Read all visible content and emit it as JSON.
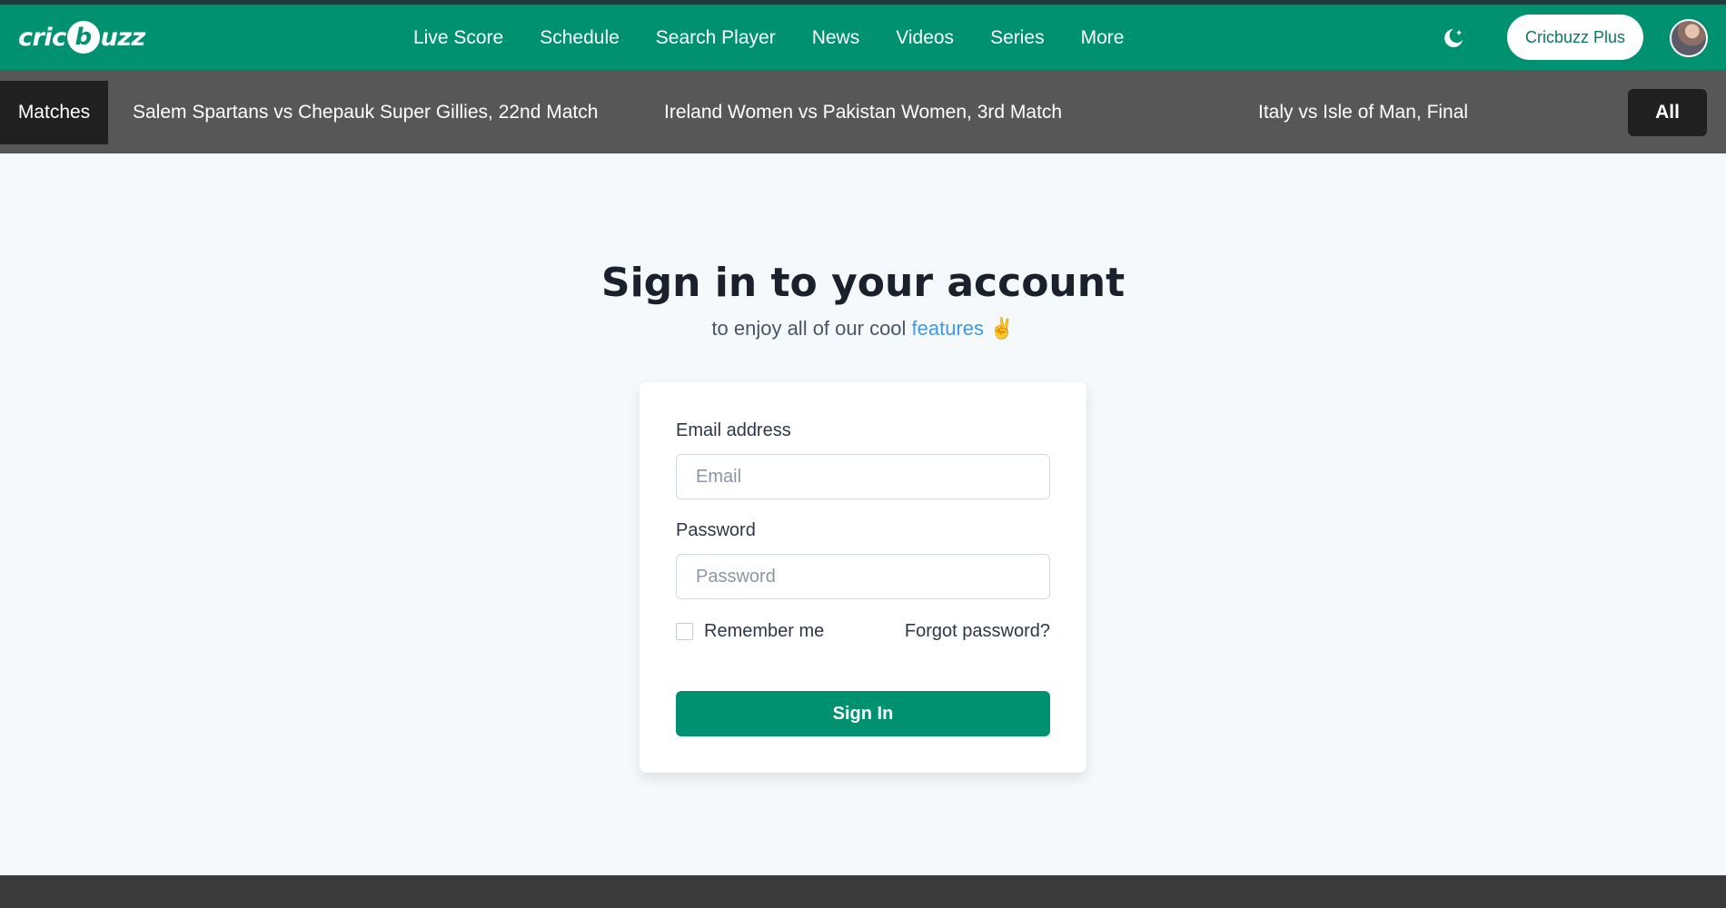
{
  "header": {
    "logo_prefix": "cric",
    "logo_ball": "b",
    "logo_suffix": "uzz",
    "nav": [
      {
        "label": "Live Score"
      },
      {
        "label": "Schedule"
      },
      {
        "label": "Search Player"
      },
      {
        "label": "News"
      },
      {
        "label": "Videos"
      },
      {
        "label": "Series"
      },
      {
        "label": "More"
      }
    ],
    "theme_icon": "moon-icon",
    "plus_label": "Cricbuzz Plus"
  },
  "matchbar": {
    "label": "Matches",
    "matches": [
      {
        "title": "Salem Spartans vs Chepauk Super Gillies, 22nd Match"
      },
      {
        "title": "Ireland Women vs Pakistan Women, 3rd Match"
      },
      {
        "title": "Italy vs Isle of Man, Final"
      }
    ],
    "all_label": "All"
  },
  "signin": {
    "title": "Sign in to your account",
    "subtitle_pre": "to enjoy all of our cool ",
    "subtitle_link": "features",
    "subtitle_emoji": "✌️",
    "email_label": "Email address",
    "email_placeholder": "Email",
    "password_label": "Password",
    "password_placeholder": "Password",
    "remember_label": "Remember me",
    "forgot_label": "Forgot password?",
    "submit_label": "Sign In"
  },
  "colors": {
    "brand": "#009270",
    "matchbar": "#575757",
    "link": "#4299e1"
  }
}
